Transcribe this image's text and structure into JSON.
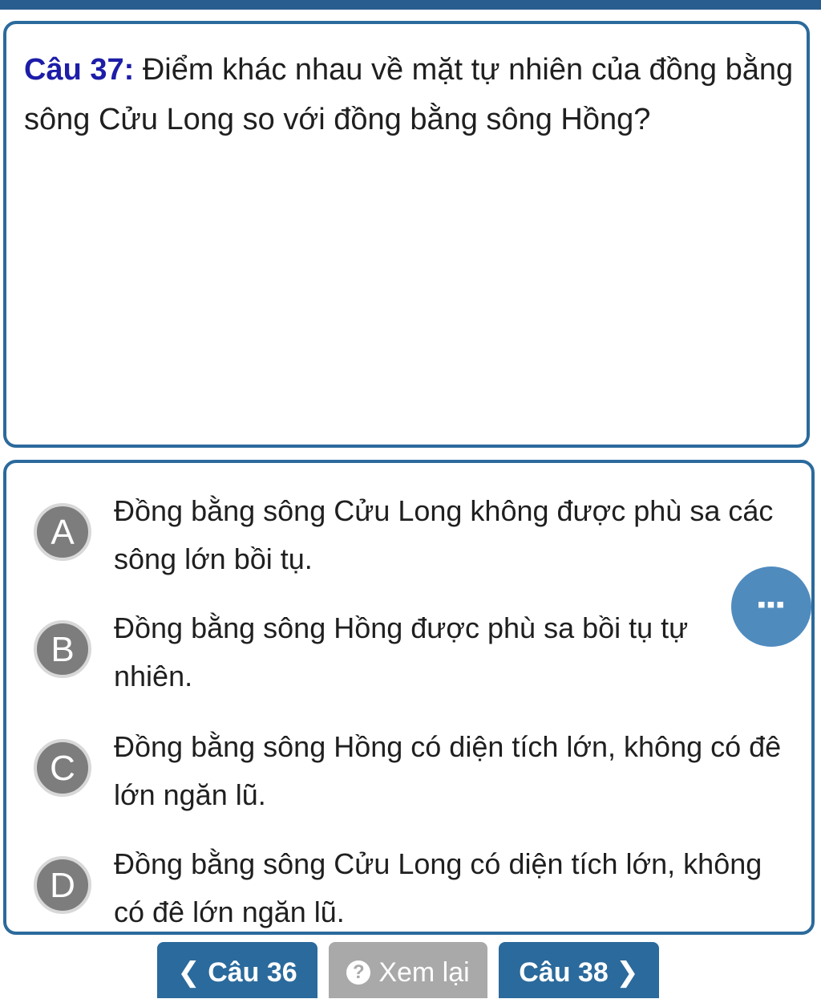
{
  "question": {
    "label": "Câu 37:",
    "text": " Điểm khác nhau về mặt tự nhiên của đồng bằng sông Cửu Long so với đồng bằng sông Hồng?"
  },
  "options": [
    {
      "letter": "A",
      "text": "Đồng bằng sông Cửu Long không được phù sa các sông lớn bồi tụ."
    },
    {
      "letter": "B",
      "text": "Đồng bằng sông Hồng được phù sa bồi tụ tự nhiên."
    },
    {
      "letter": "C",
      "text": "Đồng bằng sông Hồng có diện tích lớn, không có đê lớn ngăn lũ."
    },
    {
      "letter": "D",
      "text": "Đồng bằng sông Cửu Long có diện tích lớn, không có đê lớn ngăn lũ."
    }
  ],
  "more_button": {
    "icon": "more-dots-icon",
    "glyph": "▪▪▪"
  },
  "nav": {
    "prev_chevron": "❮",
    "prev_label": "Câu 36",
    "review_icon": "?",
    "review_label": "Xem lại",
    "next_label": "Câu 38",
    "next_chevron": "❯"
  },
  "colors": {
    "accent": "#2b6a9c",
    "question_label": "#1d1da8",
    "option_circle": "#7d7d7d",
    "review_button": "#a9a9a9"
  }
}
